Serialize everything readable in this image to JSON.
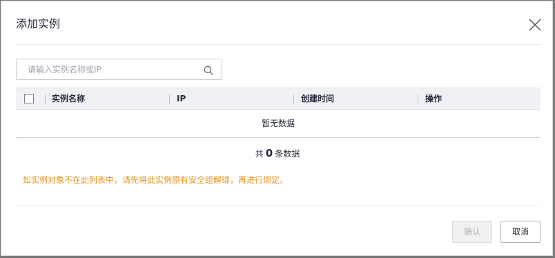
{
  "dialog": {
    "title": "添加实例"
  },
  "search": {
    "placeholder": "请输入实例名称或IP"
  },
  "table": {
    "columns": [
      "实例名称",
      "IP",
      "创建时间",
      "操作"
    ],
    "empty_text": "暂无数据"
  },
  "pagination": {
    "prefix": "共",
    "count": "0",
    "suffix": "条数据"
  },
  "notice": "如实例对象不在此列表中，请先将此实例原有安全组解绑，再进行绑定。",
  "footer": {
    "confirm_label": "确认",
    "cancel_label": "取消"
  },
  "colors": {
    "notice": "#e39421",
    "header_bg": "#f0f1f5",
    "confirm_disabled_bg": "#f1f1f1"
  },
  "icons": {
    "close": "close-icon",
    "search": "search-icon"
  }
}
